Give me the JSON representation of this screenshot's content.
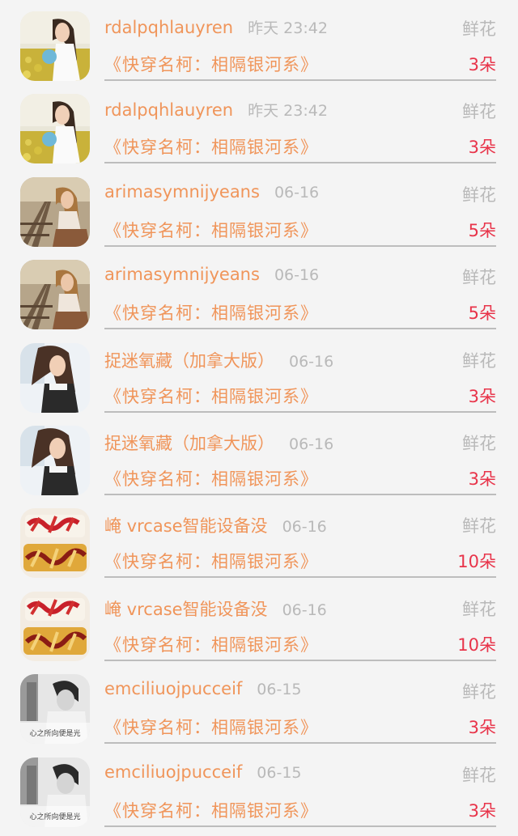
{
  "records": [
    {
      "user": "rdalpqhlauyren",
      "time": "昨天 23:42",
      "gift": "鲜花",
      "book": "《快穿名柯：相隔银河系》",
      "count": "3朵",
      "avatar": "girl-field-avatar"
    },
    {
      "user": "rdalpqhlauyren",
      "time": "昨天 23:42",
      "gift": "鲜花",
      "book": "《快穿名柯：相隔银河系》",
      "count": "3朵",
      "avatar": "girl-field-avatar"
    },
    {
      "user": "arimasymnijyeans",
      "time": "06-16",
      "gift": "鲜花",
      "book": "《快穿名柯：相隔银河系》",
      "count": "5朵",
      "avatar": "girl-railway-avatar"
    },
    {
      "user": "arimasymnijyeans",
      "time": "06-16",
      "gift": "鲜花",
      "book": "《快穿名柯：相隔银河系》",
      "count": "5朵",
      "avatar": "girl-railway-avatar"
    },
    {
      "user": "捉迷氧藏（加拿大版）",
      "time": "06-16",
      "gift": "鲜花",
      "book": "《快穿名柯：相隔银河系》",
      "count": "3朵",
      "avatar": "girl-hair-avatar"
    },
    {
      "user": "捉迷氧藏（加拿大版）",
      "time": "06-16",
      "gift": "鲜花",
      "book": "《快穿名柯：相隔银河系》",
      "count": "3朵",
      "avatar": "girl-hair-avatar"
    },
    {
      "user": "崦 vrcase智能设备没",
      "time": "06-16",
      "gift": "鲜花",
      "book": "《快穿名柯：相隔银河系》",
      "count": "10朵",
      "avatar": "new-year-logo-avatar"
    },
    {
      "user": "崦 vrcase智能设备没",
      "time": "06-16",
      "gift": "鲜花",
      "book": "《快穿名柯：相隔银河系》",
      "count": "10朵",
      "avatar": "new-year-logo-avatar"
    },
    {
      "user": "emciliuojpucceif",
      "time": "06-15",
      "gift": "鲜花",
      "book": "《快穿名柯：相隔银河系》",
      "count": "3朵",
      "avatar": "bw-boy-avatar",
      "avatar_caption": "心之所向便是光"
    },
    {
      "user": "emciliuojpucceif",
      "time": "06-15",
      "gift": "鲜花",
      "book": "《快穿名柯：相隔银河系》",
      "count": "3朵",
      "avatar": "bw-boy-avatar",
      "avatar_caption": "心之所向便是光"
    }
  ],
  "colors": {
    "accent": "#f0955a",
    "count": "#e8344a",
    "muted": "#b9b9b9",
    "background": "#f4f4f4"
  }
}
